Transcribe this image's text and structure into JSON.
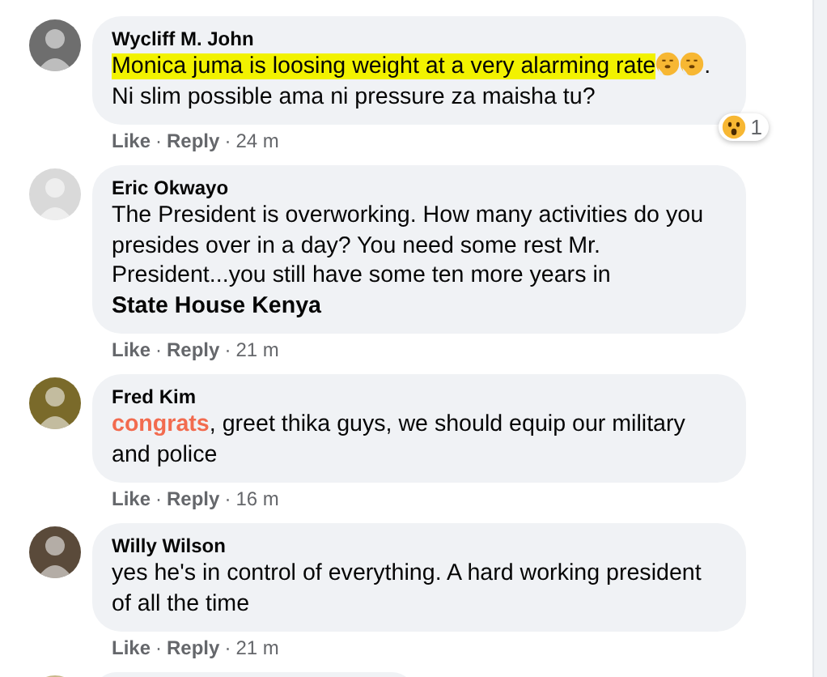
{
  "separator": "·",
  "comments": [
    {
      "author": "Wycliff M. John",
      "segments": [
        {
          "kind": "plain",
          "text": "Monica juma is loosing weight at a very alarming rate",
          "highlighted": true
        },
        {
          "kind": "emoji"
        },
        {
          "kind": "emoji"
        },
        {
          "kind": "plain",
          "text": ". Ni slim possible ama ni pressure za maisha tu?"
        }
      ],
      "reaction": {
        "count": "1"
      },
      "actions": [
        "Like",
        "Reply",
        "24 m"
      ]
    },
    {
      "author": "Eric Okwayo",
      "segments": [
        {
          "kind": "plain",
          "text": "The President is overworking. How many activities do you presides over in a day? You need some rest Mr. President...you still have some ten more years in "
        },
        {
          "kind": "mention",
          "text": "State House Kenya"
        }
      ],
      "actions": [
        "Like",
        "Reply",
        "21 m"
      ]
    },
    {
      "author": "Fred Kim",
      "segments": [
        {
          "kind": "keyword",
          "text": "congrats"
        },
        {
          "kind": "plain",
          "text": ", greet thika guys, we should equip our military and police"
        }
      ],
      "actions": [
        "Like",
        "Reply",
        "16 m"
      ]
    },
    {
      "author": "Willy Wilson",
      "segments": [
        {
          "kind": "plain",
          "text": "yes he's in control of everything. A hard working president of all the time"
        }
      ],
      "actions": [
        "Like",
        "Reply",
        "21 m"
      ]
    }
  ]
}
